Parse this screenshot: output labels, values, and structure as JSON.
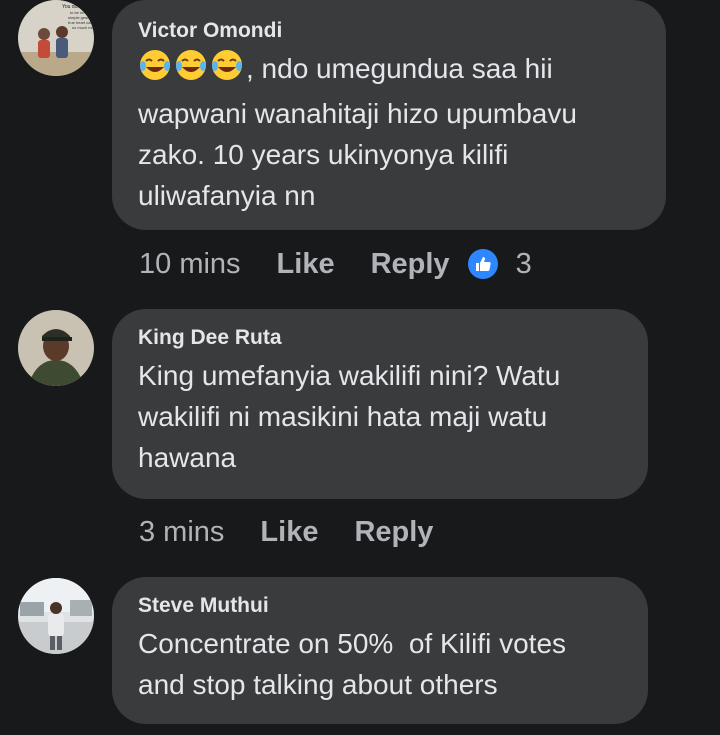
{
  "comments": [
    {
      "author": "Victor Omondi",
      "emoji_prefix": [
        "face-with-tears-of-joy",
        "face-with-tears-of-joy",
        "face-with-tears-of-joy"
      ],
      "text_after_emoji": ", ndo umegundua saa hii\nwapwani wanahitaji hizo upumbavu\nzako. 10 years ukinyonya kilifi\nuliwafanyia nn",
      "time": "10 mins",
      "like_label": "Like",
      "reply_label": "Reply",
      "reaction_icon": "thumbs-up-icon",
      "reaction_count": "3",
      "avatar_text": "You don't\nto be rema\nsimple gesture wa\ntrue heart can me\nso much more"
    },
    {
      "author": "King Dee Ruta",
      "text": "King umefanyia wakilifi nini? Watu\nwakilifi ni masikini hata maji watu\nhawana",
      "time": "3 mins",
      "like_label": "Like",
      "reply_label": "Reply"
    },
    {
      "author": "Steve Muthui",
      "text": "Concentrate on 50%  of Kilifi votes\nand stop talking about others"
    }
  ],
  "colors": {
    "background": "#18191a",
    "bubble": "#3a3b3c",
    "text": "#e4e6eb",
    "meta": "#b0b3b8",
    "reaction": "#2d88ff"
  }
}
